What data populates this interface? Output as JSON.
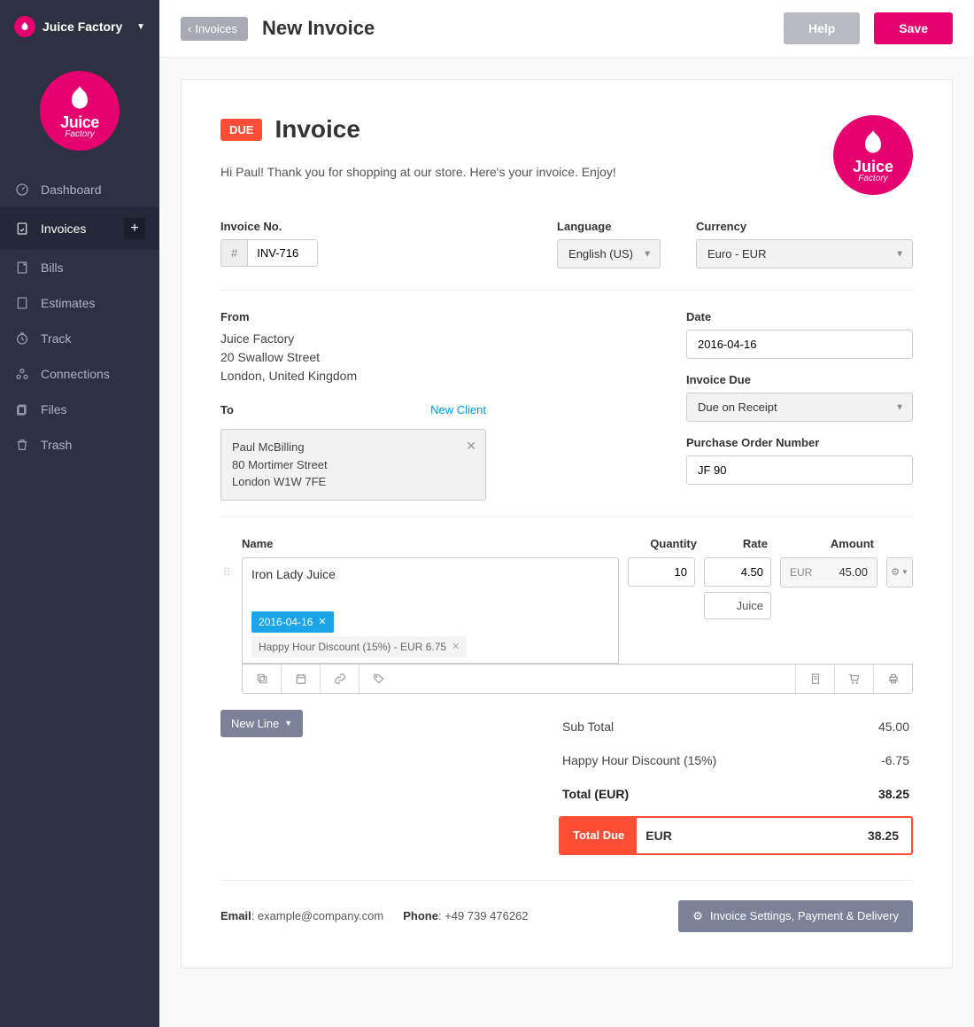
{
  "org": {
    "name": "Juice Factory"
  },
  "nav": {
    "dashboard": "Dashboard",
    "invoices": "Invoices",
    "bills": "Bills",
    "estimates": "Estimates",
    "track": "Track",
    "connections": "Connections",
    "files": "Files",
    "trash": "Trash"
  },
  "topbar": {
    "back": "Invoices",
    "title": "New Invoice",
    "help": "Help",
    "save": "Save"
  },
  "invoice": {
    "badge": "DUE",
    "title": "Invoice",
    "greeting": "Hi Paul! Thank you for shopping at our store. Here's your invoice. Enjoy!",
    "labels": {
      "invoice_no": "Invoice No.",
      "language": "Language",
      "currency": "Currency",
      "from": "From",
      "to": "To",
      "new_client": "New Client",
      "date": "Date",
      "invoice_due": "Invoice Due",
      "po_number": "Purchase Order Number"
    },
    "invoice_no_hash": "#",
    "invoice_no": "INV-716",
    "language": "English (US)",
    "currency": "Euro - EUR",
    "from": {
      "name": "Juice Factory",
      "street": "20 Swallow Street",
      "city": "London, United Kingdom"
    },
    "to": {
      "name": "Paul McBilling",
      "street": "80 Mortimer Street",
      "city": "London W1W 7FE"
    },
    "date": "2016-04-16",
    "due": "Due on Receipt",
    "po": "JF 90"
  },
  "lines": {
    "headers": {
      "name": "Name",
      "qty": "Quantity",
      "rate": "Rate",
      "amount": "Amount"
    },
    "item": {
      "name": "Iron Lady Juice",
      "qty": "10",
      "rate": "4.50",
      "category": "Juice",
      "amount_cur": "EUR",
      "amount": "45.00",
      "date_tag": "2016-04-16",
      "discount_tag": "Happy Hour Discount (15%) - EUR 6.75"
    },
    "new_line": "New Line"
  },
  "totals": {
    "subtotal_label": "Sub Total",
    "subtotal": "45.00",
    "discount_label": "Happy Hour Discount (15%)",
    "discount": "-6.75",
    "total_label": "Total (EUR)",
    "total": "38.25",
    "due_label": "Total Due",
    "due_cur": "EUR",
    "due_amount": "38.25"
  },
  "footer": {
    "email_label": "Email",
    "email": "example@company.com",
    "phone_label": "Phone",
    "phone": "+49 739 476262",
    "settings_btn": "Invoice Settings, Payment & Delivery"
  },
  "logo": {
    "line1": "Juice",
    "line2": "Factory"
  }
}
